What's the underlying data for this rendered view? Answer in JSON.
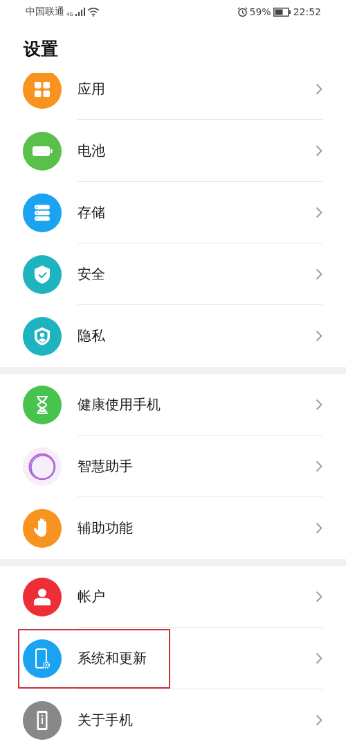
{
  "status_bar": {
    "carrier": "中国联通",
    "network": "4G",
    "battery_percent": "59%",
    "time": "22:52"
  },
  "title": "设置",
  "groups": [
    {
      "items": [
        {
          "label": "应用",
          "highlighted": false
        },
        {
          "label": "电池",
          "highlighted": false
        },
        {
          "label": "存储",
          "highlighted": false
        },
        {
          "label": "安全",
          "highlighted": false
        },
        {
          "label": "隐私",
          "highlighted": false
        }
      ]
    },
    {
      "items": [
        {
          "label": "健康使用手机",
          "highlighted": false
        },
        {
          "label": "智慧助手",
          "highlighted": false
        },
        {
          "label": "辅助功能",
          "highlighted": false
        }
      ]
    },
    {
      "items": [
        {
          "label": "帐户",
          "highlighted": false
        },
        {
          "label": "系统和更新",
          "highlighted": true
        },
        {
          "label": "关于手机",
          "highlighted": false
        }
      ]
    }
  ]
}
